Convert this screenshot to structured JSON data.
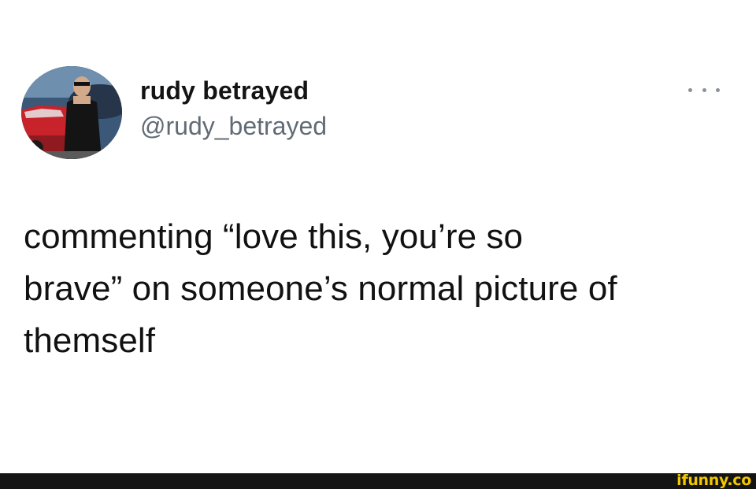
{
  "tweet": {
    "author": {
      "display_name": "rudy betrayed",
      "handle": "@rudy_betrayed",
      "avatar_icon": "profile-photo-avatar"
    },
    "more_icon": "more-horizontal-icon",
    "text_lines": [
      "commenting “love this, you’re so",
      "brave” on someone’s normal picture of",
      "themself"
    ]
  },
  "footer": {
    "watermark": "ifunny.co",
    "watermark_color": "#f3c700"
  }
}
